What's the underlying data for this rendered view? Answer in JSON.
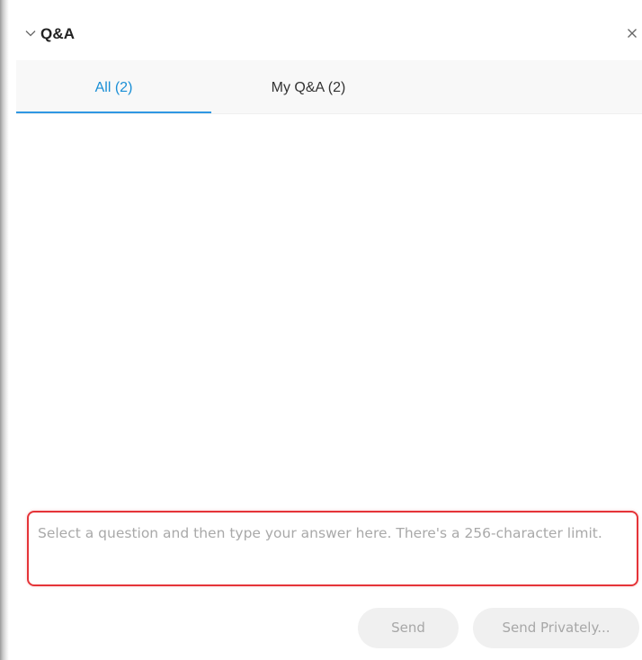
{
  "panel": {
    "title": "Q&A",
    "icons": {
      "collapse": "chevron-down-icon",
      "close": "close-icon"
    }
  },
  "tabs": [
    {
      "label": "All (2)",
      "selected": true
    },
    {
      "label": "My Q&A (2)",
      "selected": false
    }
  ],
  "answer_input": {
    "value": "",
    "placeholder": "Select a question and then type your answer here. There's a 256-character limit."
  },
  "buttons": {
    "send_label": "Send",
    "send_privately_label": "Send Privately..."
  },
  "colors": {
    "accent": "#2f97e3",
    "highlight_border": "#e53438",
    "disabled_button_bg": "#f0f0f0",
    "disabled_button_text": "#a7a7a7"
  }
}
